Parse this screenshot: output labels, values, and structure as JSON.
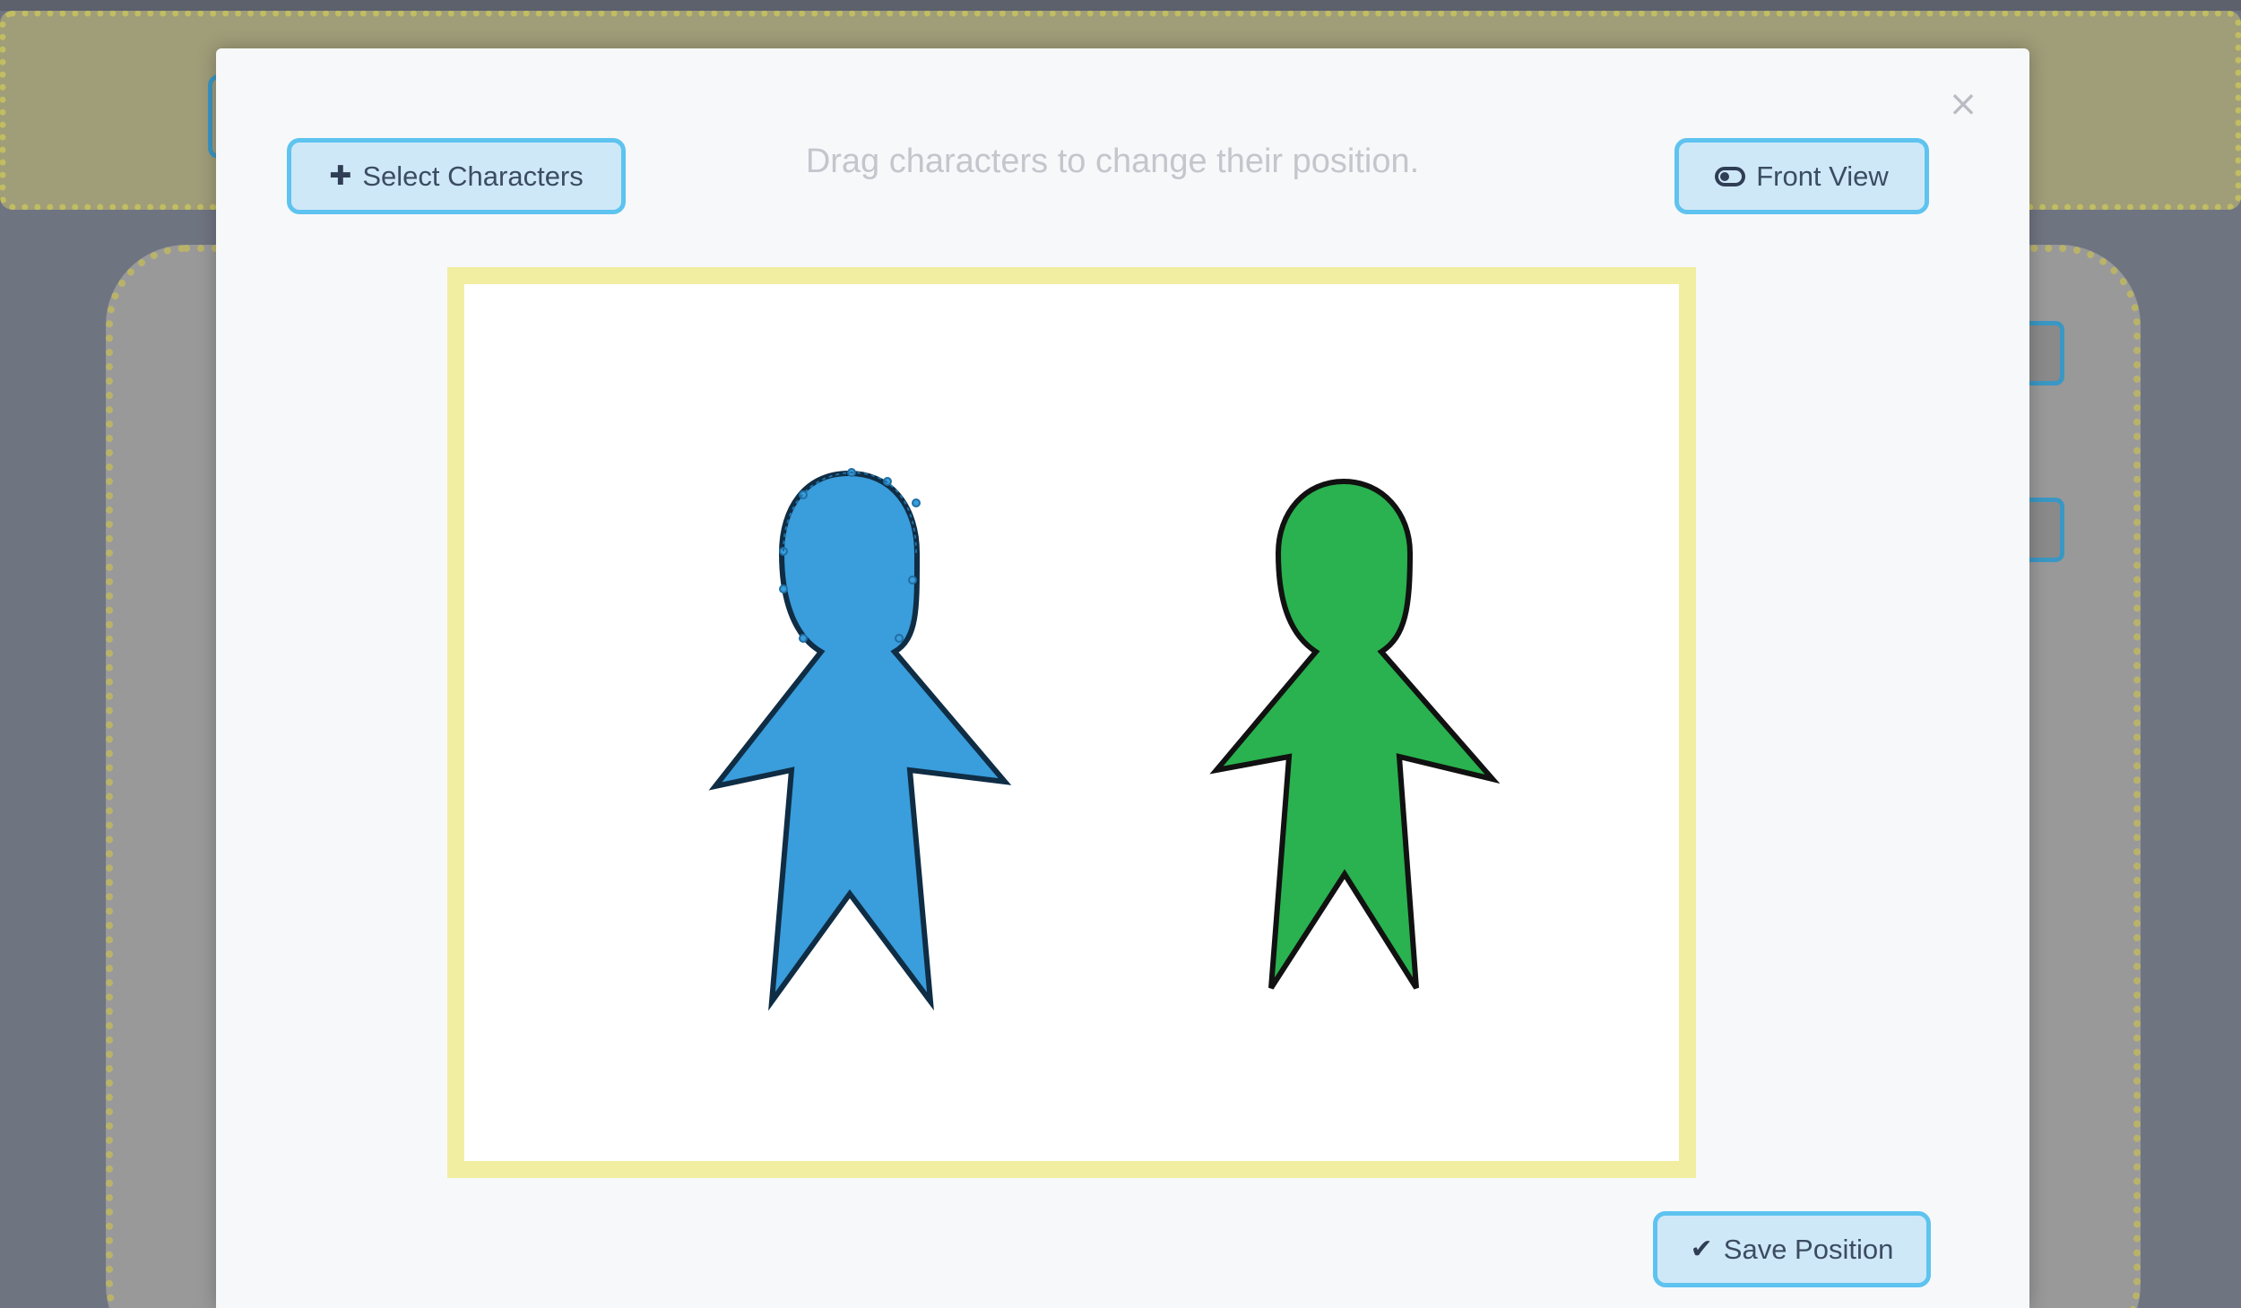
{
  "modal": {
    "close_label": "×",
    "hint": "Drag characters to change their position.",
    "select_button": {
      "icon": "plus-icon",
      "label": "Select Characters"
    },
    "view_button": {
      "icon": "toggle-icon",
      "label": "Front View"
    },
    "save_button": {
      "icon": "checkmark-icon",
      "label": "Save Position"
    }
  },
  "stage": {
    "border_color": "#f1eea1",
    "characters": [
      {
        "name": "blue-character",
        "fill": "#3a9ddc",
        "selected": true
      },
      {
        "name": "green-character",
        "fill": "#29b24f",
        "selected": false
      }
    ]
  }
}
